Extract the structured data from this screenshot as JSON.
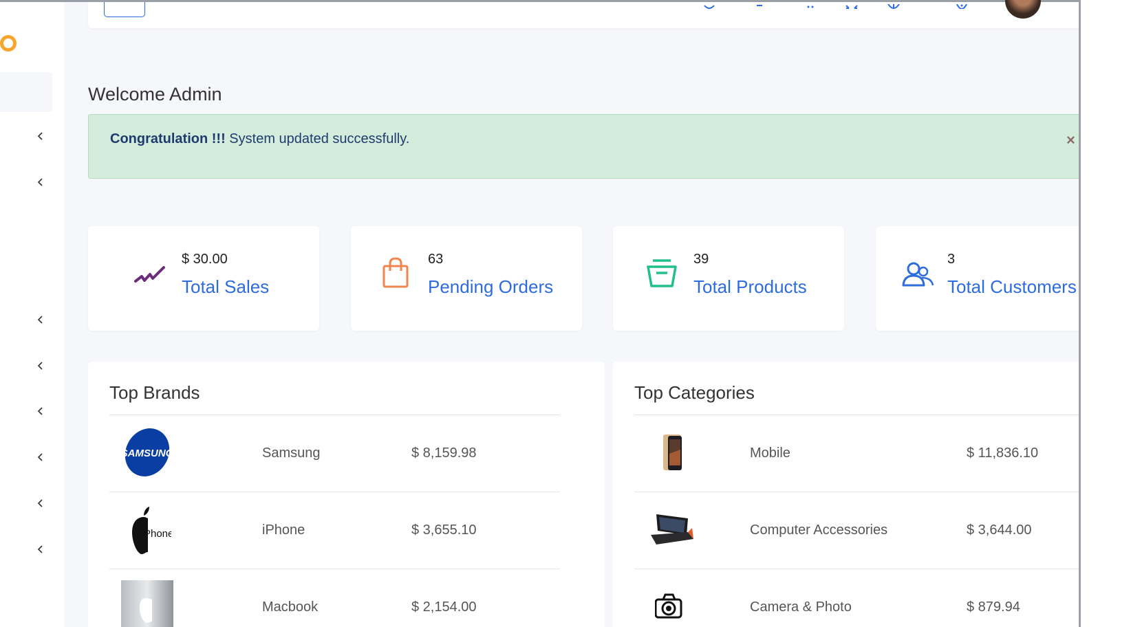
{
  "welcome_title": "Welcome Admin",
  "alert": {
    "strong": "Congratulation !!!",
    "message": " System updated successfully.",
    "close": "×"
  },
  "stats": [
    {
      "value": "$ 30.00",
      "label": "Total Sales",
      "icon": "trend-icon",
      "color": "#6b2d7a"
    },
    {
      "value": "63",
      "label": "Pending Orders",
      "icon": "shopping-bag-icon",
      "color": "#f08550"
    },
    {
      "value": "39",
      "label": "Total Products",
      "icon": "product-box-icon",
      "color": "#20c08a"
    },
    {
      "value": "3",
      "label": "Total Customers",
      "icon": "users-icon",
      "color": "#2d6cdf"
    }
  ],
  "top_brands": {
    "title": "Top Brands",
    "rows": [
      {
        "name": "Samsung",
        "amount": "$ 8,159.98",
        "logo_text": "SAMSUNG"
      },
      {
        "name": "iPhone",
        "amount": "$ 3,655.10",
        "logo_text": "iPhone"
      },
      {
        "name": "Macbook",
        "amount": "$ 2,154.00"
      }
    ]
  },
  "top_categories": {
    "title": "Top Categories",
    "rows": [
      {
        "name": "Mobile",
        "amount": "$ 11,836.10"
      },
      {
        "name": "Computer Accessories",
        "amount": "$ 3,644.00"
      },
      {
        "name": "Camera & Photo",
        "amount": "$ 879.94"
      }
    ]
  },
  "colors": {
    "accent": "#2d6cdf",
    "alert_bg": "#d4ecdc",
    "logo": "#f7a52c"
  }
}
